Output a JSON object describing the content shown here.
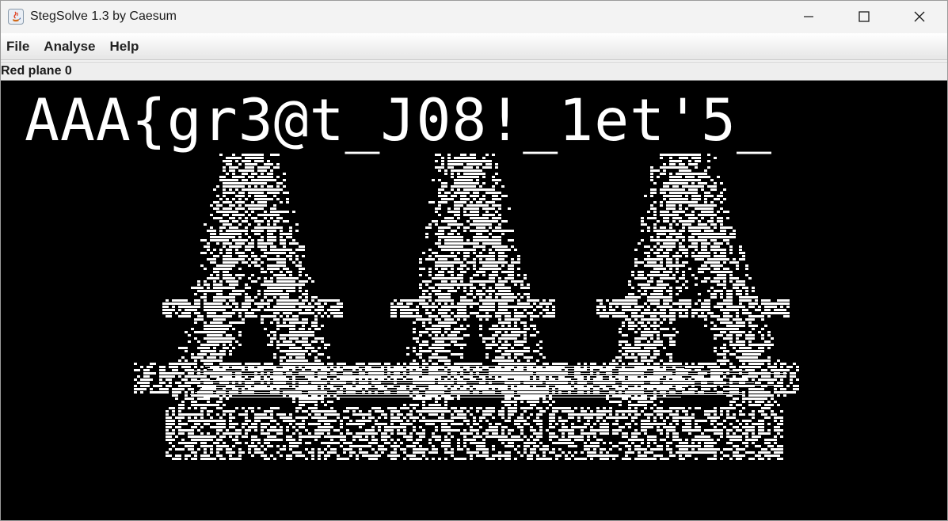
{
  "window": {
    "title": "StegSolve 1.3 by Caesum"
  },
  "menu": {
    "items": [
      "File",
      "Analyse",
      "Help"
    ]
  },
  "view": {
    "plane_label": "Red plane 0"
  },
  "image": {
    "flag_text": "AAA{gr3@t_J08!_1et'5_"
  }
}
